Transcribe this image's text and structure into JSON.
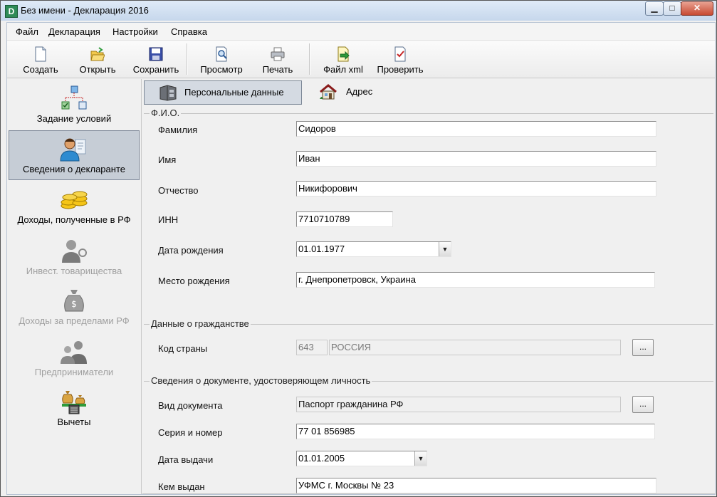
{
  "window": {
    "app_icon_letter": "D",
    "title": "Без имени - Декларация 2016",
    "min_label": "▁",
    "max_label": "□",
    "close_label": "✕"
  },
  "menu": [
    "Файл",
    "Декларация",
    "Настройки",
    "Справка"
  ],
  "toolbar": [
    {
      "label": "Создать",
      "icon": "new-document-icon"
    },
    {
      "label": "Открыть",
      "icon": "open-folder-icon"
    },
    {
      "label": "Сохранить",
      "icon": "save-disk-icon"
    },
    {
      "label": "Просмотр",
      "icon": "preview-magnifier-icon"
    },
    {
      "label": "Печать",
      "icon": "printer-icon"
    },
    {
      "label": "Файл xml",
      "icon": "xml-file-icon"
    },
    {
      "label": "Проверить",
      "icon": "check-document-icon"
    }
  ],
  "sidebar": [
    {
      "label": "Задание условий",
      "icon": "conditions-tree-icon",
      "state": "normal"
    },
    {
      "label": "Сведения о декларанте",
      "icon": "declarant-person-icon",
      "state": "selected"
    },
    {
      "label": "Доходы, полученные в РФ",
      "icon": "coins-stack-icon",
      "state": "normal"
    },
    {
      "label": "Инвест. товарищества",
      "icon": "investment-partnership-icon",
      "state": "disabled"
    },
    {
      "label": "Доходы за пределами РФ",
      "icon": "money-bag-icon",
      "state": "disabled"
    },
    {
      "label": "Предприниматели",
      "icon": "entrepreneurs-icon",
      "state": "disabled"
    },
    {
      "label": "Вычеты",
      "icon": "deductions-scales-icon",
      "state": "normal"
    }
  ],
  "tabs": [
    {
      "label": "Персональные данные",
      "icon": "personal-data-cabinet-icon",
      "active": true
    },
    {
      "label": "Адрес",
      "icon": "house-icon",
      "active": false
    }
  ],
  "fio": {
    "title": "Ф.И.О.",
    "surname_label": "Фамилия",
    "surname": "Сидоров",
    "name_label": "Имя",
    "name": "Иван",
    "patronymic_label": "Отчество",
    "patronymic": "Никифорович",
    "inn_label": "ИНН",
    "inn": "7710710789",
    "birthdate_label": "Дата рождения",
    "birthdate": "01.01.1977",
    "birthplace_label": "Место рождения",
    "birthplace": "г. Днепропетровск, Украина"
  },
  "citizenship": {
    "title": "Данные о гражданстве",
    "country_label": "Код страны",
    "country_code": "643",
    "country_name": "РОССИЯ",
    "button": "..."
  },
  "document": {
    "title": "Сведения о документе, удостоверяющем личность",
    "type_label": "Вид документа",
    "type": "Паспорт гражданина РФ",
    "button": "...",
    "series_label": "Серия и номер",
    "series": "77 01 856985",
    "issue_date_label": "Дата выдачи",
    "issue_date": "01.01.2005",
    "issuer_label": "Кем выдан",
    "issuer": "УФМС г. Москвы № 23"
  }
}
